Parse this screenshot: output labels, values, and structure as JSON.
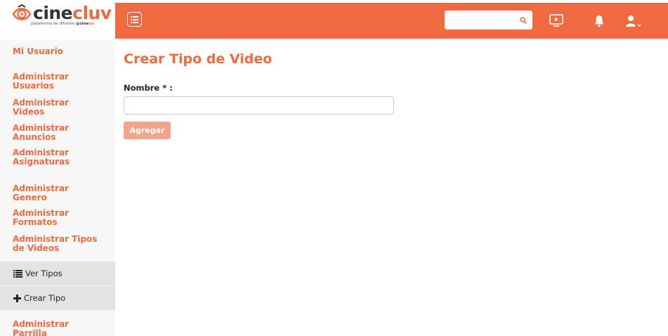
{
  "brand": {
    "name_part1": "cine",
    "name_part2": "cluv",
    "tagline": "plataforma de difusión",
    "tagline_brand_1": "@cine",
    "tagline_brand_2": "uv",
    "accent_color": "#ef6a3f"
  },
  "topbar": {
    "search_placeholder": "",
    "icons": [
      "menu-icon",
      "search-icon",
      "tv-icon",
      "bell-icon",
      "user-icon"
    ]
  },
  "sidebar": {
    "items": [
      {
        "label": "Mi Usuario"
      },
      {
        "label": "Administrar Usuarios"
      },
      {
        "label": "Administrar Videos"
      },
      {
        "label": "Administrar Anuncios"
      },
      {
        "label": "Administrar Asignaturas"
      },
      {
        "label": "Administrar Genero"
      },
      {
        "label": "Administrar Formatos"
      },
      {
        "label": "Administrar Tipos de Videos"
      },
      {
        "label": "Administrar Parrilla"
      }
    ],
    "subitems": [
      {
        "label": "Ver Tipos",
        "icon": "list-icon"
      },
      {
        "label": "Crear Tipo",
        "icon": "plus-icon"
      }
    ]
  },
  "main": {
    "title": "Crear Tipo de Video",
    "form": {
      "name_label": "Nombre * :",
      "name_value": "",
      "submit_label": "Agregar"
    }
  }
}
